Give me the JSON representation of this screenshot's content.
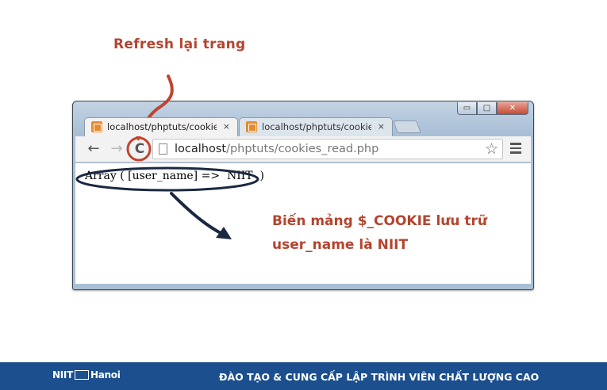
{
  "annotations": {
    "refresh_label": "Refresh lại trang",
    "cookie_note": "Biến mảng $_COOKIE lưu trữ user_name là NIIT"
  },
  "window_controls": {
    "minimize": "▭",
    "maximize": "□",
    "close": "✕"
  },
  "tabs": [
    {
      "title": "localhost/phptuts/cookie",
      "close": "×",
      "active": true
    },
    {
      "title": "localhost/phptuts/cookie",
      "close": "×",
      "active": false
    }
  ],
  "toolbar": {
    "back": "←",
    "forward": "→",
    "reload": "C",
    "url_host": "localhost",
    "url_path": "/phptuts/cookies_read.php",
    "star": "☆"
  },
  "content": {
    "output": "Array ( [user_name] =>  NIIT  )"
  },
  "footer": {
    "logo_left": "NIIT",
    "logo_right": "Hanoi",
    "tagline": "ĐÀO TẠO & CUNG CẤP LẬP TRÌNH VIÊN CHẤT LƯỢNG CAO"
  },
  "colors": {
    "annotation": "#b5442e",
    "footer_bg": "#1b4f8e",
    "arrow_dark": "#1a2840"
  },
  "icons": [
    "back-arrow-icon",
    "forward-arrow-icon",
    "reload-icon",
    "page-icon",
    "star-icon",
    "menu-icon",
    "favicon-icon"
  ]
}
